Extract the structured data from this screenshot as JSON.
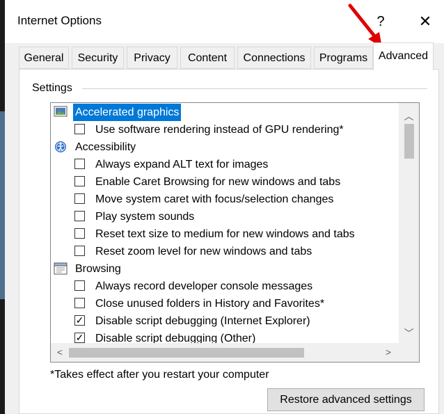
{
  "window": {
    "title": "Internet Options",
    "help_label": "?",
    "close_label": "✕"
  },
  "tabs": [
    {
      "label": "General"
    },
    {
      "label": "Security"
    },
    {
      "label": "Privacy"
    },
    {
      "label": "Content"
    },
    {
      "label": "Connections"
    },
    {
      "label": "Programs"
    },
    {
      "label": "Advanced",
      "active": true
    }
  ],
  "settings": {
    "group_label": "Settings",
    "items": [
      {
        "kind": "category",
        "label": "Accelerated graphics",
        "icon": "monitor-icon",
        "selected": true
      },
      {
        "kind": "option",
        "label": "Use software rendering instead of GPU rendering*",
        "checked": false
      },
      {
        "kind": "category",
        "label": "Accessibility",
        "icon": "accessibility-icon",
        "selected": false
      },
      {
        "kind": "option",
        "label": "Always expand ALT text for images",
        "checked": false
      },
      {
        "kind": "option",
        "label": "Enable Caret Browsing for new windows and tabs",
        "checked": false
      },
      {
        "kind": "option",
        "label": "Move system caret with focus/selection changes",
        "checked": false
      },
      {
        "kind": "option",
        "label": "Play system sounds",
        "checked": false
      },
      {
        "kind": "option",
        "label": "Reset text size to medium for new windows and tabs",
        "checked": false
      },
      {
        "kind": "option",
        "label": "Reset zoom level for new windows and tabs",
        "checked": false
      },
      {
        "kind": "category",
        "label": "Browsing",
        "icon": "browser-window-icon",
        "selected": false
      },
      {
        "kind": "option",
        "label": "Always record developer console messages",
        "checked": false
      },
      {
        "kind": "option",
        "label": "Close unused folders in History and Favorites*",
        "checked": false
      },
      {
        "kind": "option",
        "label": "Disable script debugging (Internet Explorer)",
        "checked": true
      },
      {
        "kind": "option",
        "label": "Disable script debugging (Other)",
        "checked": true
      }
    ]
  },
  "footnote": "*Takes effect after you restart your computer",
  "restore_button_label": "Restore advanced settings",
  "colors": {
    "selection": "#0078d7",
    "annotation_arrow": "#e00000"
  }
}
